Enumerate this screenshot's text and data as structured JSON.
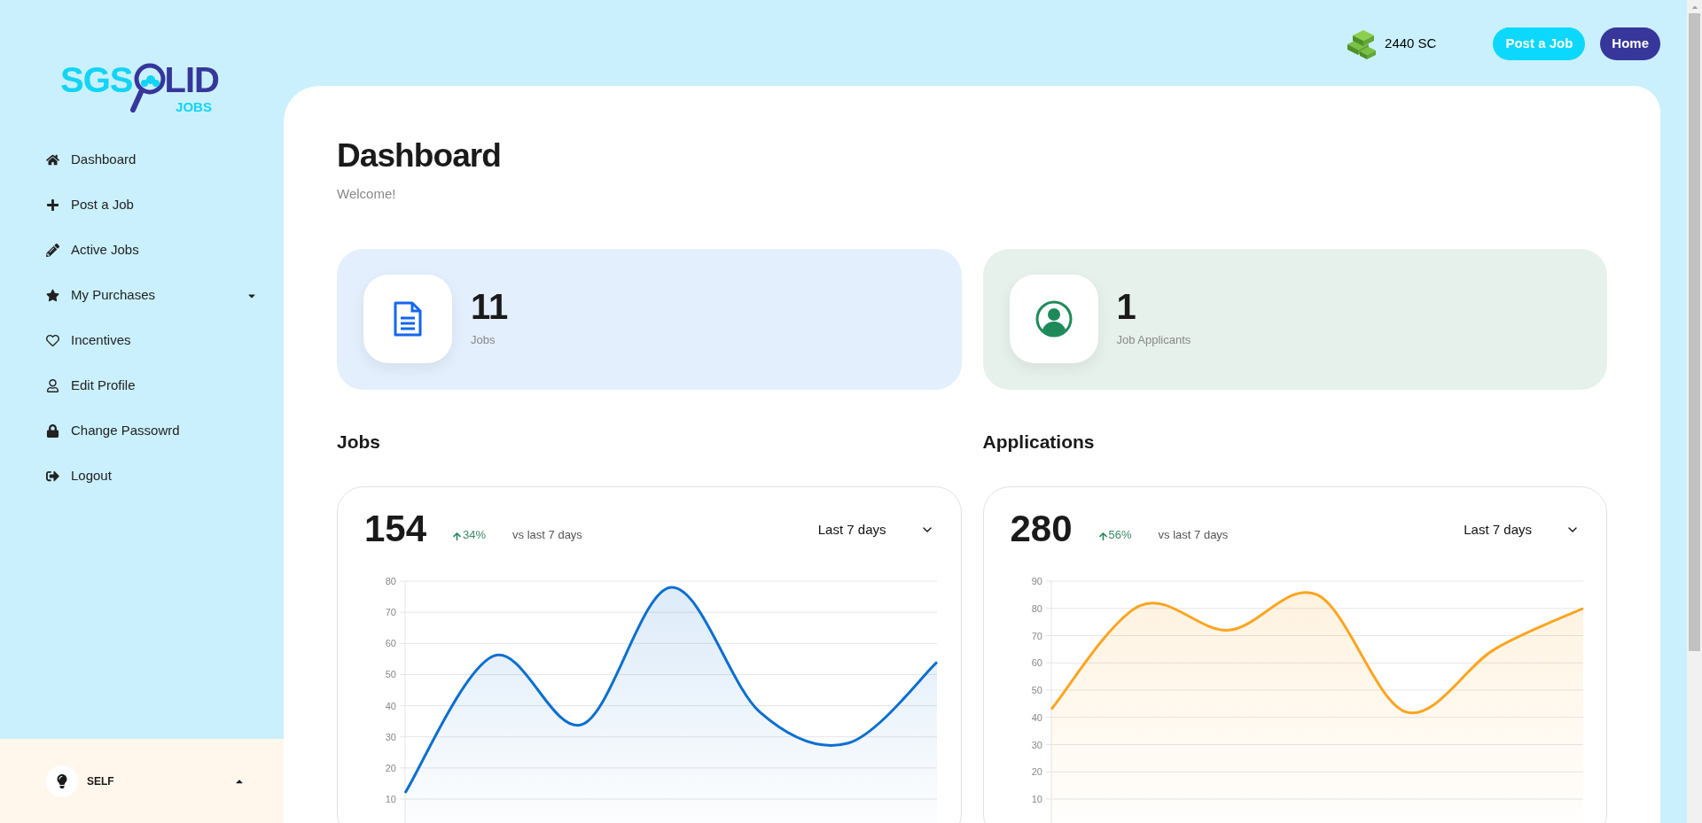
{
  "logo": {
    "left": "SGS",
    "right": "LID",
    "sub": "JOBS"
  },
  "sidebar": {
    "items": [
      {
        "label": "Dashboard",
        "has_submenu": false
      },
      {
        "label": "Post a Job",
        "has_submenu": false
      },
      {
        "label": "Active Jobs",
        "has_submenu": false
      },
      {
        "label": "My Purchases",
        "has_submenu": true
      },
      {
        "label": "Incentives",
        "has_submenu": false
      },
      {
        "label": "Edit Profile",
        "has_submenu": false
      },
      {
        "label": "Change Passowrd",
        "has_submenu": false
      },
      {
        "label": "Logout",
        "has_submenu": false
      }
    ],
    "account": {
      "label": "SELF",
      "expanded": true
    }
  },
  "header": {
    "credits": "2440 SC",
    "buttons": [
      "Post a Job",
      "Home"
    ]
  },
  "page": {
    "title": "Dashboard",
    "subtitle": "Welcome!"
  },
  "stats": [
    {
      "value": "11",
      "label": "Jobs"
    },
    {
      "value": "1",
      "label": "Job Applicants"
    }
  ],
  "panels": [
    {
      "title": "Jobs",
      "total": "154",
      "change": "34%",
      "comparison": "vs last 7 days",
      "period": "Last 7 days",
      "chart_data": {
        "type": "area",
        "grid": true,
        "ylim": [
          1,
          80
        ],
        "yticks": [
          10,
          20,
          30,
          40,
          50,
          60,
          70,
          80
        ],
        "series": [
          {
            "color": "#0a6fd0",
            "values": [
              12,
              56,
              34,
              78,
              38,
              28,
              54
            ]
          }
        ]
      }
    },
    {
      "title": "Applications",
      "total": "280",
      "change": "56%",
      "comparison": "vs last 7 days",
      "period": "Last 7 days",
      "chart_data": {
        "type": "area",
        "grid": true,
        "ylim": [
          0,
          90
        ],
        "yticks": [
          10,
          20,
          30,
          40,
          50,
          60,
          70,
          80,
          90
        ],
        "series": [
          {
            "color": "#fca520",
            "values": [
              43,
              81,
              72,
              85,
              42,
              65,
              80
            ]
          }
        ]
      }
    }
  ]
}
